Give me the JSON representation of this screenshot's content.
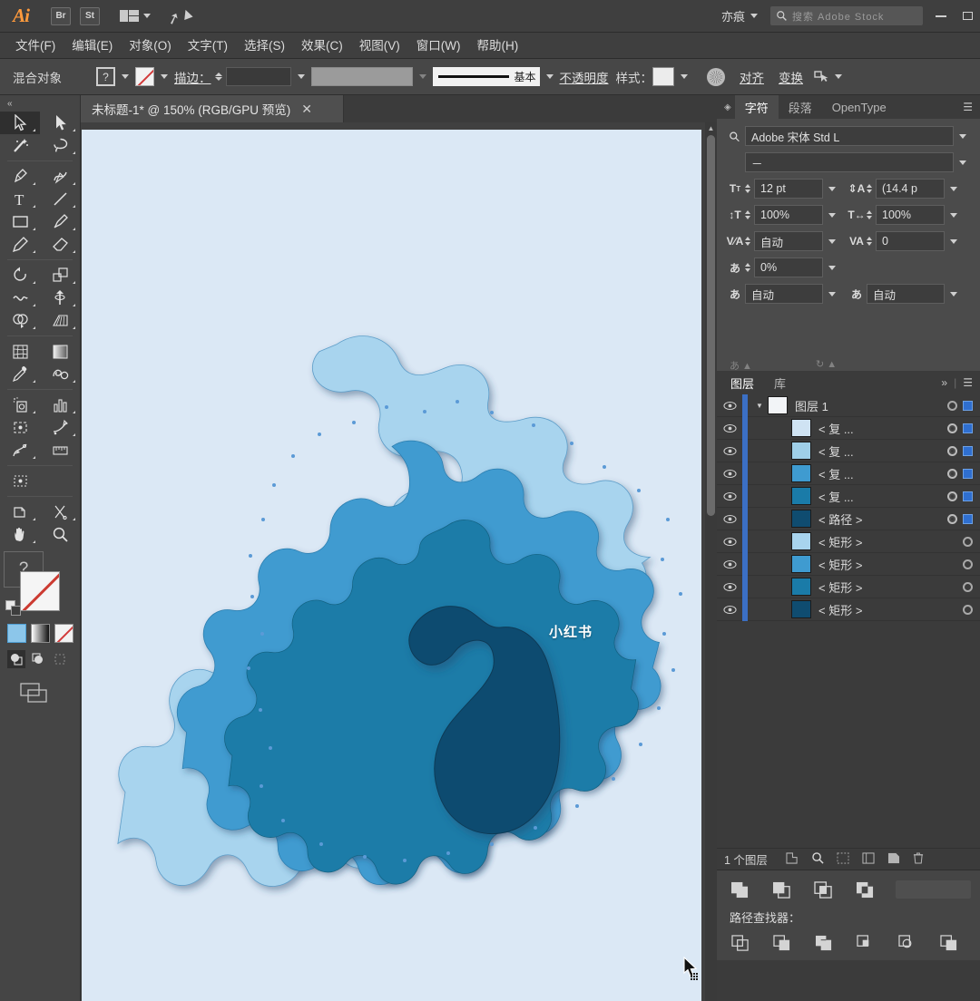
{
  "app": {
    "logo": "Ai",
    "quick_buttons": [
      {
        "name": "bridge-button",
        "label": "Br"
      },
      {
        "name": "stock-button",
        "label": "St"
      }
    ],
    "user_name": "亦痕",
    "stock_search_placeholder": "搜索 Adobe Stock",
    "window_controls": [
      "minimize",
      "maximize"
    ]
  },
  "menubar": {
    "items": [
      {
        "label": "文件(F)"
      },
      {
        "label": "编辑(E)"
      },
      {
        "label": "对象(O)"
      },
      {
        "label": "文字(T)"
      },
      {
        "label": "选择(S)"
      },
      {
        "label": "效果(C)"
      },
      {
        "label": "视图(V)"
      },
      {
        "label": "窗口(W)"
      },
      {
        "label": "帮助(H)"
      }
    ]
  },
  "controlbar": {
    "selection_label": "混合对象",
    "fill_swatch": "?",
    "stroke_label": "描边：",
    "stroke_weight_value": "",
    "stroke_profile_label": "基本",
    "opacity_label": "不透明度",
    "style_label": "样式：",
    "align_label": "对齐",
    "transform_label": "变换"
  },
  "toolbar": {
    "tools": [
      {
        "name": "selection-tool",
        "label": "选择工具",
        "selected": true
      },
      {
        "name": "direct-selection-tool",
        "label": "直接选择工具",
        "selected": false
      },
      {
        "name": "magic-wand-tool",
        "label": "魔棒工具",
        "selected": false
      },
      {
        "name": "lasso-tool",
        "label": "套索工具",
        "selected": false
      },
      {
        "name": "pen-tool",
        "label": "钢笔工具",
        "selected": false
      },
      {
        "name": "curvature-tool",
        "label": "曲率工具",
        "selected": false
      },
      {
        "name": "type-tool",
        "label": "文字工具",
        "selected": false
      },
      {
        "name": "line-segment-tool",
        "label": "直线段工具",
        "selected": false
      },
      {
        "name": "rectangle-tool",
        "label": "矩形工具",
        "selected": false
      },
      {
        "name": "paintbrush-tool",
        "label": "画笔工具",
        "selected": false
      },
      {
        "name": "pencil-tool",
        "label": "铅笔工具",
        "selected": false
      },
      {
        "name": "eraser-tool",
        "label": "橡皮擦工具",
        "selected": false
      },
      {
        "name": "rotate-tool",
        "label": "旋转工具",
        "selected": false
      },
      {
        "name": "scale-tool",
        "label": "比例缩放工具",
        "selected": false
      },
      {
        "name": "width-tool",
        "label": "宽度工具",
        "selected": false
      },
      {
        "name": "free-transform-tool",
        "label": "自由变换工具",
        "selected": false
      },
      {
        "name": "shape-builder-tool",
        "label": "形状生成器工具",
        "selected": false
      },
      {
        "name": "perspective-grid-tool",
        "label": "透视网格工具",
        "selected": false
      },
      {
        "name": "mesh-tool",
        "label": "网格工具",
        "selected": false
      },
      {
        "name": "gradient-tool",
        "label": "渐变工具",
        "selected": false
      },
      {
        "name": "eyedropper-tool",
        "label": "吸管工具",
        "selected": false
      },
      {
        "name": "blend-tool",
        "label": "混合工具",
        "selected": false
      },
      {
        "name": "symbol-sprayer-tool",
        "label": "符号喷枪工具",
        "selected": false
      },
      {
        "name": "column-graph-tool",
        "label": "柱形图工具",
        "selected": false
      },
      {
        "name": "artboard-tool",
        "label": "画板工具",
        "selected": false
      },
      {
        "name": "slice-tool",
        "label": "切片工具",
        "selected": false
      },
      {
        "name": "puppet-warp-tool",
        "label": "操控变形工具",
        "selected": false
      },
      {
        "name": "measure-tool",
        "label": "度量工具",
        "selected": false
      },
      {
        "name": "crop-image-tool",
        "label": "裁剪图像工具",
        "selected": false
      },
      {
        "name": "scissors-tool",
        "label": "剪刀工具",
        "selected": false
      },
      {
        "name": "hand-tool",
        "label": "抓手工具",
        "selected": false
      },
      {
        "name": "zoom-tool",
        "label": "缩放工具",
        "selected": false
      }
    ],
    "help_glyph": "?",
    "color_modes": [
      {
        "name": "fill-color-mode",
        "label": "颜色",
        "color": "#8cc6ea"
      },
      {
        "name": "gradient-mode",
        "label": "渐变"
      },
      {
        "name": "none-mode",
        "label": "无"
      }
    ],
    "draw_modes": [
      {
        "name": "draw-normal",
        "label": "正常绘图",
        "selected": true
      },
      {
        "name": "draw-behind",
        "label": "背面绘图",
        "selected": false
      },
      {
        "name": "draw-inside",
        "label": "内部绘图",
        "selected": false
      }
    ]
  },
  "document": {
    "tab_title": "未标题-1* @ 150% (RGB/GPU 预览)",
    "zoom": "150%",
    "color_mode": "RGB",
    "preview": "GPU 预览",
    "artboard_background": "#dbe8f5",
    "watermark": "小红书",
    "artwork": {
      "title": "分层剪纸风格形状",
      "layer_colors": [
        "#a8d4ee",
        "#3f9bd0",
        "#1a7ba8",
        "#0f4c70"
      ]
    }
  },
  "character_panel": {
    "tabs": [
      {
        "name": "tab-character",
        "label": "字符",
        "active": true
      },
      {
        "name": "tab-paragraph",
        "label": "段落",
        "active": false
      },
      {
        "name": "tab-opentype",
        "label": "OpenType",
        "active": false
      }
    ],
    "font_family": "Adobe 宋体 Std L",
    "font_style": "－",
    "font_size": "12 pt",
    "leading": "(14.4 p",
    "vertical_scale": "100%",
    "horizontal_scale": "100%",
    "kerning": "自动",
    "tracking": "0",
    "baseline_shift_percent": "0%",
    "tsume_left": "自动",
    "tsume_right": "自动"
  },
  "layers_panel": {
    "tabs": [
      {
        "name": "tab-layers",
        "label": "图层",
        "active": true
      },
      {
        "name": "tab-libraries",
        "label": "库",
        "active": false
      }
    ],
    "rows": [
      {
        "name": "图层 1",
        "type": "layer",
        "thumb": "#f2f4f7",
        "indent": 0,
        "target_double": false,
        "selected": true,
        "expanded": true
      },
      {
        "name": "< 复 ...",
        "type": "object",
        "thumb": "#cfe3f3",
        "indent": 1,
        "target_double": true,
        "selected": true,
        "expanded": false
      },
      {
        "name": "< 复 ...",
        "type": "object",
        "thumb": "#9fcfe8",
        "indent": 1,
        "target_double": true,
        "selected": true,
        "expanded": false
      },
      {
        "name": "< 复 ...",
        "type": "object",
        "thumb": "#3f9bd0",
        "indent": 1,
        "target_double": true,
        "selected": true,
        "expanded": false
      },
      {
        "name": "< 复 ...",
        "type": "object",
        "thumb": "#1a7ba8",
        "indent": 1,
        "target_double": true,
        "selected": true,
        "expanded": false
      },
      {
        "name": "< 路径 >",
        "type": "path",
        "thumb": "#0f4c70",
        "indent": 1,
        "target_double": true,
        "selected": true,
        "expanded": false
      },
      {
        "name": "< 矩形 >",
        "type": "rect",
        "thumb": "#a8d4ee",
        "indent": 1,
        "target_double": false,
        "selected": false,
        "expanded": false
      },
      {
        "name": "< 矩形 >",
        "type": "rect",
        "thumb": "#3f9bd0",
        "indent": 1,
        "target_double": false,
        "selected": false,
        "expanded": false
      },
      {
        "name": "< 矩形 >",
        "type": "rect",
        "thumb": "#1a7ba8",
        "indent": 1,
        "target_double": false,
        "selected": false,
        "expanded": false
      },
      {
        "name": "< 矩形 >",
        "type": "rect",
        "thumb": "#0f4c70",
        "indent": 1,
        "target_double": false,
        "selected": false,
        "expanded": false
      }
    ],
    "footer_count": "1 个图层",
    "footer_buttons": [
      {
        "name": "locate-object-button",
        "label": "定位对象"
      },
      {
        "name": "make-clipping-mask-button",
        "label": "建立/释放剪切蒙版"
      },
      {
        "name": "make-sublayer-button",
        "label": "创建新子图层"
      },
      {
        "name": "new-layer-button",
        "label": "创建新图层"
      },
      {
        "name": "delete-layer-button",
        "label": "删除所选图层"
      }
    ]
  },
  "pathfinder_panel": {
    "title": "路径查找器：",
    "shape_modes": [
      {
        "name": "unite-button",
        "label": "联集"
      },
      {
        "name": "minus-front-button",
        "label": "减去顶层"
      },
      {
        "name": "intersect-button",
        "label": "交集"
      },
      {
        "name": "exclude-button",
        "label": "差集"
      },
      {
        "name": "expand-button",
        "label": "扩展"
      }
    ],
    "pathfinders": [
      {
        "name": "divide-button",
        "label": "分割"
      },
      {
        "name": "trim-button",
        "label": "修边"
      },
      {
        "name": "merge-button",
        "label": "合并"
      },
      {
        "name": "crop-button",
        "label": "裁剪"
      },
      {
        "name": "outline-button",
        "label": "轮廓"
      },
      {
        "name": "minus-back-button",
        "label": "减去后方对象"
      }
    ]
  },
  "colors": {
    "chrome": "#3b3b3b",
    "panel": "#4b4b4b",
    "accent": "#2f6fd0",
    "artboard": "#dbe8f5",
    "logo": "#ff9a3c"
  }
}
